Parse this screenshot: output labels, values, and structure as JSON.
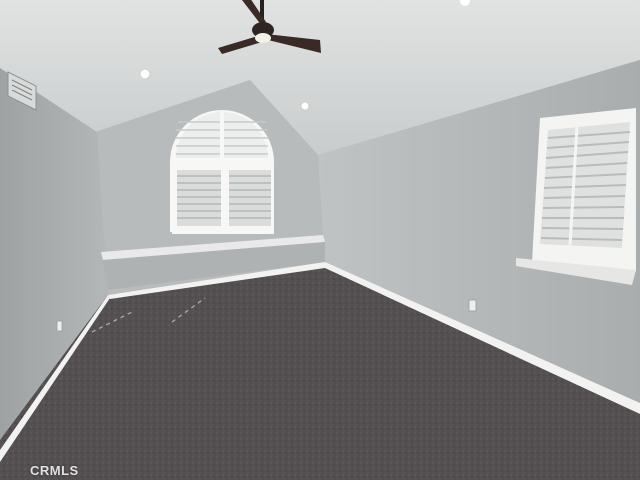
{
  "photo": {
    "subject": "empty-bonus-room",
    "watermark": "CRMLS"
  },
  "colors": {
    "wall": "#b5b9ba",
    "ceiling": "#d6d8d8",
    "carpet": "#5c5658",
    "trim": "#f2f2f0",
    "fan_blade": "#3a2a26"
  },
  "icons": {
    "ceiling_fan": "ceiling-fan-icon",
    "recessed_light": "recessed-light-icon",
    "vent": "air-vent-icon",
    "outlet": "power-outlet-icon"
  }
}
